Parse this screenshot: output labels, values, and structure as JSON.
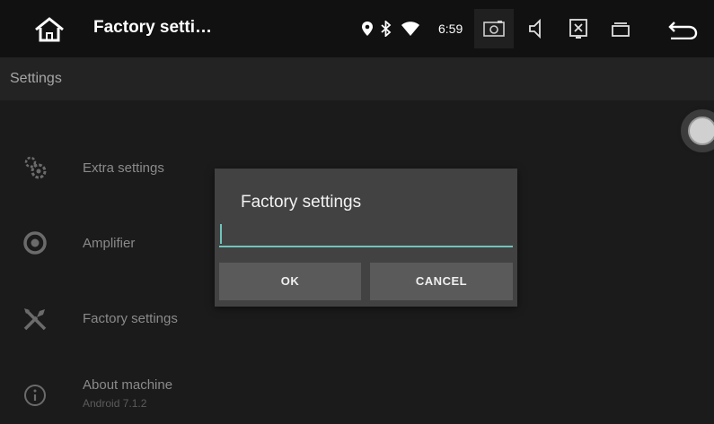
{
  "status_bar": {
    "title": "Factory setti…",
    "time": "6:59",
    "icons": [
      "home-icon",
      "location-icon",
      "bluetooth-icon",
      "wifi-icon",
      "screenshot-icon",
      "volume-icon",
      "close-app-icon",
      "recent-apps-icon",
      "back-icon"
    ]
  },
  "header": {
    "title": "Settings"
  },
  "list": {
    "items": [
      {
        "label": "Extra settings",
        "icon": "gears-icon"
      },
      {
        "label": "Amplifier",
        "icon": "speaker-icon"
      },
      {
        "label": "Factory settings",
        "icon": "tools-icon"
      },
      {
        "label": "About machine",
        "sub": "Android 7.1.2",
        "icon": "info-icon"
      }
    ]
  },
  "dialog": {
    "title": "Factory settings",
    "input_value": "",
    "ok_label": "OK",
    "cancel_label": "CANCEL"
  },
  "colors": {
    "accent": "#70c4bc",
    "background": "#1b1b1b",
    "dialog": "#424242"
  }
}
